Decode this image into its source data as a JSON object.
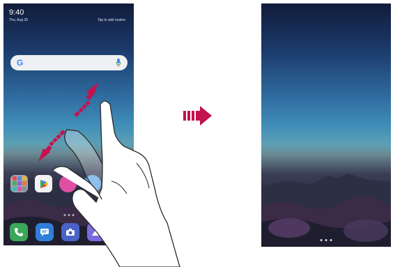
{
  "left_phone": {
    "clock": "9:40",
    "date": "Thu, Aug 30",
    "tap_to_edit": "Tap to add routine",
    "search_logo": "G",
    "icons": {
      "folder": "folder-icon",
      "play_store": "play-store-icon",
      "app_pink": "app-icon",
      "app_blue": "app-icon",
      "phone": "phone-icon",
      "messages": "messages-icon",
      "camera": "camera-icon",
      "gallery": "gallery-icon",
      "mic": "mic-icon"
    }
  },
  "gesture": {
    "type": "pinch-out",
    "illustration": "hand-icon"
  },
  "transition_arrow": "arrow-right-icon",
  "colors": {
    "accent_arrow": "#c4124e",
    "phone_icon": "#3aa75a",
    "messages_icon": "#2f7fd9",
    "camera_icon": "#4a63c8",
    "gallery_icon": "#7b6be0"
  }
}
